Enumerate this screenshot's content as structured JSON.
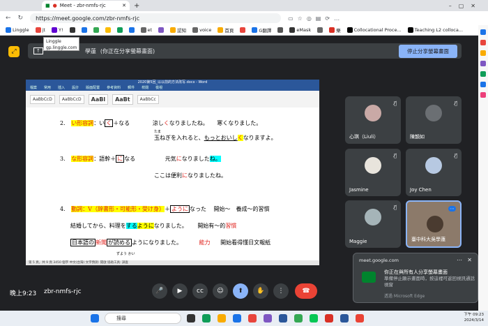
{
  "browser": {
    "tab_title": "Meet - zbr-nmfs-rjc",
    "url": "https://meet.google.com/zbr-nmfs-rjc"
  },
  "bookmarks": [
    "Linggle",
    "jt",
    "Y!",
    "",
    "",
    "",
    "",
    "",
    "",
    "et",
    "",
    "認知",
    "voice",
    "首頁",
    "",
    "G翻譯",
    "",
    "eMask",
    "",
    "樂",
    "Collocational Proce...",
    "Teaching L2 colloca..."
  ],
  "tooltip": {
    "title": "Linggle",
    "sub": "gp.linggle.com"
  },
  "share": {
    "text": "(你正在分享螢幕畫面)",
    "prefix": "學蓮",
    "stop": "停止分享螢幕畫面"
  },
  "word": {
    "title": "2020第5回_以以前的方法改写.docx - Word",
    "status": "第 5 頁，共 9 頁  3450 個字 中文(台灣) 文字預測: 開啟  協助工具: 調查"
  },
  "doc": {
    "l1_num": "2.",
    "l1_a": "い形容詞",
    "l1_b": "：い",
    "l1_c": "く",
    "l1_d": "＋なる",
    "l1_e": "涼し",
    "l1_f": "く",
    "l1_g": "なりましたね。",
    "l1_h": "寒くなりました。",
    "ruby1": "たま",
    "l2_a": "玉ねぎを入れると、",
    "l2_b": "もっとおいし",
    "l2_c": "く",
    "l2_d": "なりますよ。",
    "l3_num": "3.",
    "l3_a": "な形容詞",
    "l3_b": "：語幹＋",
    "l3_c": "に",
    "l3_d": "なる",
    "l3_e": "元気",
    "l3_f": "に",
    "l3_g": "なりました",
    "l3_h": "ね。",
    "l4_a": "ここは便利",
    "l4_b": "に",
    "l4_c": "なりましたね。",
    "l5_num": "4.",
    "l5_a": "動詞",
    "l5_b": "：V（辞書形・可能形・受け身）",
    "l5_c": "＋",
    "l5_d": "ように",
    "l5_e": "なった",
    "l5_f": "開始～　養成～的習慣",
    "l6_a": "結婚してから、料理を",
    "l6_b": "する",
    "l6_c": "ように",
    "l6_d": "なりました。",
    "l6_e": "開始有～的",
    "l6_f": "習慣",
    "l7_a": "日本語の",
    "l7_b": "新聞",
    "l7_c": "が読める",
    "l7_d": "ようになりました。",
    "l7_e": "能力",
    "l7_f": "開始看得懂日文報紙",
    "ruby2": "ずよう かい"
  },
  "tiles": [
    {
      "name": "心琪（Liuli）"
    },
    {
      "name": "陳韻如"
    },
    {
      "name": "Jasmine"
    },
    {
      "name": "Joy Chen"
    },
    {
      "name": "Maggie"
    },
    {
      "name": "臺中科大吳學蓮"
    }
  ],
  "notif": {
    "site": "meet.google.com",
    "title": "你正在與所有人分享螢幕畫面",
    "body": "準備停止顯示畫面時，按這裡可返回視訊通話視窗",
    "via": "透過 Microsoft Edge"
  },
  "meeting": {
    "time": "晚上9:23",
    "code": "zbr-nmfs-rjc"
  },
  "taskbar": {
    "search": "搜尋",
    "time": "下午 09:23",
    "date": "2024/3/14"
  }
}
